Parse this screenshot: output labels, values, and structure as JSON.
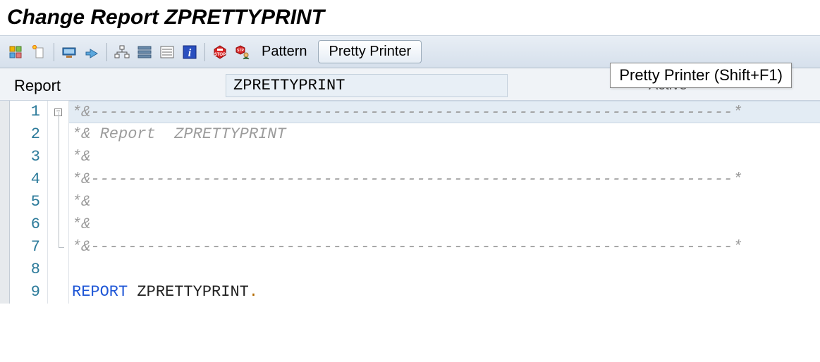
{
  "title": "Change Report ZPRETTYPRINT",
  "toolbar": {
    "pattern_label": "Pattern",
    "pretty_printer_label": "Pretty Printer"
  },
  "tooltip": "Pretty Printer   (Shift+F1)",
  "info": {
    "label": "Report",
    "value": "ZPRETTYPRINT",
    "status": "Active"
  },
  "code": {
    "lines": [
      "*&---------------------------------------------------------------------*",
      "*& Report  ZPRETTYPRINT",
      "*&",
      "*&---------------------------------------------------------------------*",
      "*&",
      "*&",
      "*&---------------------------------------------------------------------*",
      "",
      "REPORT ZPRETTYPRINT."
    ],
    "line_numbers": [
      "1",
      "2",
      "3",
      "4",
      "5",
      "6",
      "7",
      "8",
      "9"
    ]
  }
}
